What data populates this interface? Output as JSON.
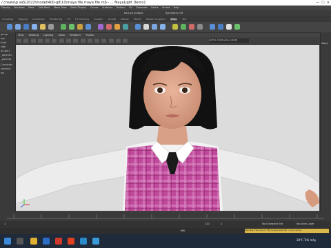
{
  "title": "/ create\\p sa5\\2022\\model\\400-g8\\10\\maya file.maya file.mb - ... MayaLight Demo1",
  "menus": [
    "Display",
    "Windows",
    "Mesh",
    "Edit Mesh",
    "Mesh Tools",
    "Mesh Display",
    "Curves",
    "Surfaces",
    "Deform",
    "UV",
    "Generate",
    "Cache",
    "Arnold",
    "Help"
  ],
  "status": {
    "no_live_surface": "No Live Surface",
    "symmetry": "Symmetry: Off"
  },
  "shelf_tabs": [
    "Sculpting",
    "Rigging",
    "Animation",
    "Rendering",
    "FX",
    "FX Caching",
    "Custom",
    "Arnold",
    "Bifrost",
    "MASH",
    "Motion Graphics",
    "XGen",
    "Yeti"
  ],
  "active_shelf": "XGen",
  "panel_menu": [
    "View",
    "Shading",
    "Lighting",
    "Show",
    "Renderer",
    "Panels"
  ],
  "panel_field": "ACES 1.0 SDR-video (sRGB)",
  "outliner": [
    "persp",
    "top",
    "front",
    "side",
    "pCube1",
    "_parentLi",
    "_parent2",
    "",
    "Constrain",
    "contract",
    "ew"
  ],
  "right_label": "Maya",
  "timeline": {
    "start": "1",
    "end": "120",
    "current": "1",
    "no_character_set": "No Character Set",
    "no_anim_layer": "No Anim Layer",
    "fps": "24 fps"
  },
  "cmd_label": "MEL",
  "warning": "Warning: File Import \"file:System\\Normal\" could not be",
  "taskbar": {
    "search_placeholder": "",
    "weather": "28°C Trời mây",
    "time": ""
  },
  "colors": {
    "viewport_bg": "#dcdcdc",
    "vest_pink": "#c0469a",
    "shirt": "#f2f2f2"
  }
}
